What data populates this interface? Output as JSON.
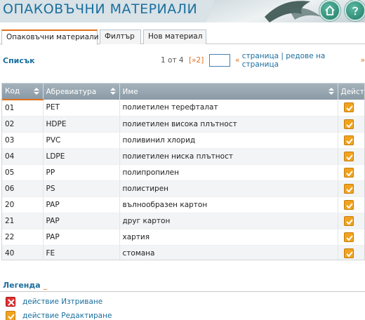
{
  "header": {
    "title": "ОПАКОВЪЧНИ МАТЕРИАЛИ",
    "home_icon": "home-icon",
    "help_icon": "help-icon"
  },
  "tabs": [
    {
      "label": "Опаковъчни материали",
      "active": true
    },
    {
      "label": "Филтър",
      "active": false
    },
    {
      "label": "Нов материал",
      "active": false
    }
  ],
  "list": {
    "label": "Списък",
    "pager": {
      "count": "1 от 4",
      "next": "[»2]",
      "page_input_value": "",
      "links_prefix": "«",
      "links_text": "страница | редове на страница",
      "links_suffix": "»"
    }
  },
  "table": {
    "columns": [
      "Код",
      "Абревиатура",
      "Име",
      "Действие"
    ],
    "rows": [
      {
        "code": "01",
        "abbr": "PET",
        "name": "полиетилен терефталат"
      },
      {
        "code": "02",
        "abbr": "HDPE",
        "name": "полиетилен висока плътност"
      },
      {
        "code": "03",
        "abbr": "PVC",
        "name": "поливинил хлорид"
      },
      {
        "code": "04",
        "abbr": "LDPE",
        "name": "полиетилен ниска плътност"
      },
      {
        "code": "05",
        "abbr": "PP",
        "name": "полипропилен"
      },
      {
        "code": "06",
        "abbr": "PS",
        "name": "полистирен"
      },
      {
        "code": "20",
        "abbr": "PAP",
        "name": "вълнообразен картон"
      },
      {
        "code": "21",
        "abbr": "PAP",
        "name": "друг картон"
      },
      {
        "code": "22",
        "abbr": "PAP",
        "name": "хартия"
      },
      {
        "code": "40",
        "abbr": "FE",
        "name": "стомана"
      }
    ]
  },
  "legend": {
    "title": "Легенда",
    "underscore": "_",
    "items": [
      {
        "icon": "delete-icon",
        "label": "действие Изтриване"
      },
      {
        "icon": "edit-icon",
        "label": "действие Редактиране"
      }
    ]
  },
  "colors": {
    "accent": "#e0701a",
    "link": "#1a6f9e",
    "header_bg": "#8a9aa5",
    "edit_icon": "#f1a31f",
    "delete_icon": "#dd3333"
  }
}
